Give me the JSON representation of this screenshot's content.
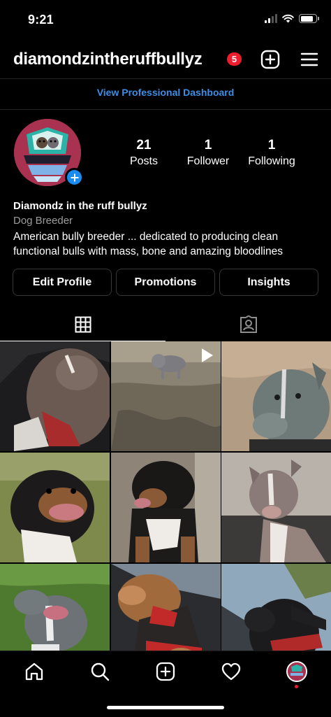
{
  "status_bar": {
    "time": "9:21"
  },
  "header": {
    "username": "diamondzintheruffbullyz",
    "notification_count": "5"
  },
  "dashboard_link": "View Professional Dashboard",
  "profile": {
    "stats": [
      {
        "value": "21",
        "label": "Posts"
      },
      {
        "value": "1",
        "label": "Follower"
      },
      {
        "value": "1",
        "label": "Following"
      }
    ],
    "display_name": "Diamondz in the ruff bullyz",
    "category": "Dog Breeder",
    "bio": "American bully breeder ... dedicated to producing clean functional bulls with mass, bone and amazing bloodlines"
  },
  "buttons": {
    "edit_profile": "Edit Profile",
    "promotions": "Promotions",
    "insights": "Insights"
  },
  "colors": {
    "link_blue": "#3b8fe6",
    "badge_red": "#ed1c2e",
    "avatar_add_blue": "#1a8cf0"
  },
  "photos": [
    {
      "name": "photo-brown-bully-sleeping-on-car-seat"
    },
    {
      "name": "photo-grey-puppy-on-dirt-video"
    },
    {
      "name": "photo-blue-puppy-on-blanket"
    },
    {
      "name": "photo-tricolor-bully-on-grass"
    },
    {
      "name": "photo-black-tan-bully-sitting"
    },
    {
      "name": "photo-lilac-puppy-standing"
    },
    {
      "name": "photo-blue-bully-lying-in-grass"
    },
    {
      "name": "photo-bully-in-car-red-harness"
    },
    {
      "name": "photo-bully-at-car-window"
    }
  ]
}
